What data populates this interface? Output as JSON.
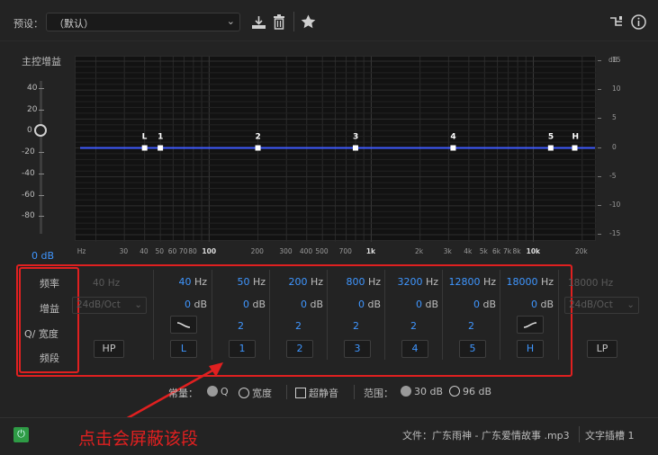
{
  "header": {
    "preset_label": "预设：",
    "preset_value": "（默认）",
    "icons": [
      "download-icon",
      "trash-icon",
      "star-icon",
      "routing-icon",
      "info-icon"
    ]
  },
  "master_gain": {
    "label": "主控增益",
    "ticks": [
      "40",
      "20",
      "0",
      "-20",
      "-40",
      "-60",
      "-80"
    ],
    "value": "0 dB"
  },
  "graph": {
    "db_unit": "dB",
    "db_ticks": [
      "15",
      "10",
      "5",
      "0",
      "-5",
      "-10",
      "-15"
    ],
    "freq_ticks": [
      "Hz",
      "30",
      "40",
      "50",
      "60",
      "70",
      "80",
      "100",
      "200",
      "300",
      "400",
      "500",
      "700",
      "1k",
      "2k",
      "3k",
      "4k",
      "5k",
      "6k",
      "7k",
      "8k",
      "10k",
      "20k"
    ],
    "points": [
      {
        "label": "L",
        "freq_hz": 40,
        "gain_db": 0
      },
      {
        "label": "1",
        "freq_hz": 50,
        "gain_db": 0
      },
      {
        "label": "2",
        "freq_hz": 200,
        "gain_db": 0
      },
      {
        "label": "3",
        "freq_hz": 800,
        "gain_db": 0
      },
      {
        "label": "4",
        "freq_hz": 3200,
        "gain_db": 0
      },
      {
        "label": "5",
        "freq_hz": 12800,
        "gain_db": 0
      },
      {
        "label": "H",
        "freq_hz": 18000,
        "gain_db": 0
      }
    ]
  },
  "bands": {
    "row_labels": {
      "freq": "频率",
      "gain": "增益",
      "q": "Q/ 宽度",
      "band": "频段"
    },
    "hp": {
      "freq": "40 Hz",
      "slope": "24dB/Oct",
      "button": "HP"
    },
    "lp": {
      "freq": "18000 Hz",
      "slope": "24dB/Oct",
      "button": "LP"
    },
    "items": [
      {
        "freq": "40",
        "gain": "0",
        "q": "",
        "button": "L"
      },
      {
        "freq": "50",
        "gain": "0",
        "q": "2",
        "button": "1"
      },
      {
        "freq": "200",
        "gain": "0",
        "q": "2",
        "button": "2"
      },
      {
        "freq": "800",
        "gain": "0",
        "q": "2",
        "button": "3"
      },
      {
        "freq": "3200",
        "gain": "0",
        "q": "2",
        "button": "4"
      },
      {
        "freq": "12800",
        "gain": "0",
        "q": "2",
        "button": "5"
      },
      {
        "freq": "18000",
        "gain": "0",
        "q": "",
        "button": "H"
      }
    ],
    "freq_unit": "Hz",
    "gain_unit": "dB"
  },
  "options": {
    "constant_label": "常量：",
    "q_label": "Q",
    "width_label": "宽度",
    "ultra_mute_label": "超静音",
    "range_label": "范围：",
    "range_30": "30 dB",
    "range_96": "96 dB"
  },
  "status": {
    "file": "文件：广东雨神 - 广东爱情故事 .mp3",
    "slot": "文字插槽 1"
  },
  "annotation": "点击会屏蔽该段",
  "colors": {
    "accent": "#3f96ff",
    "annotation": "#e02020",
    "curve": "#3f5bff"
  }
}
